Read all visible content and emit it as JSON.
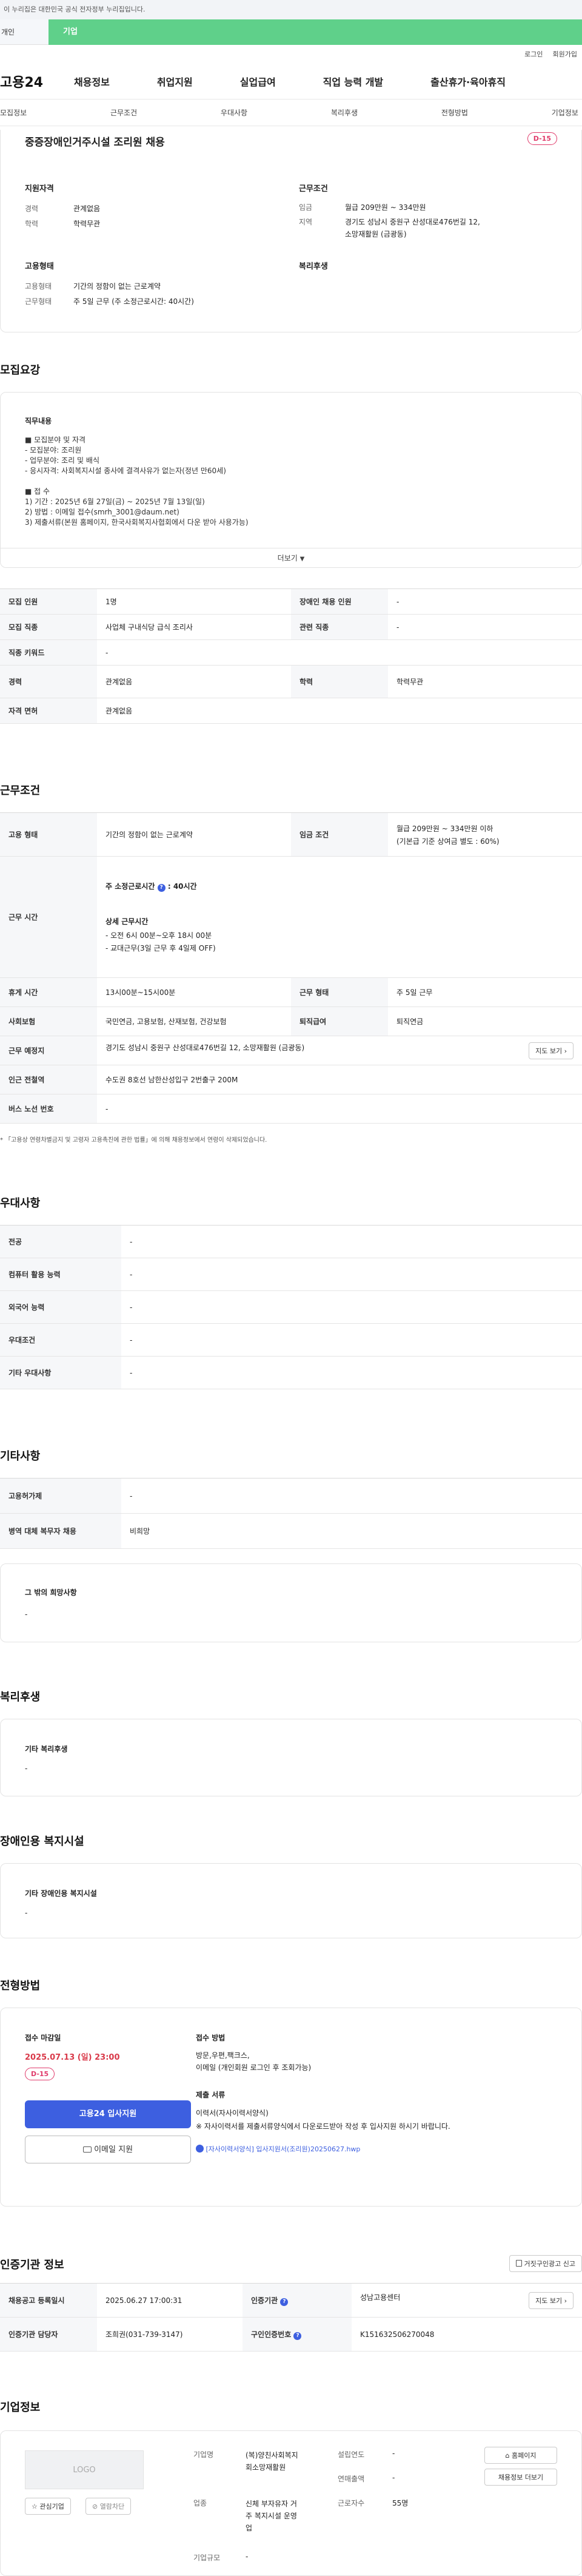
{
  "gov_notice": "이 누리집은 대한민국 공식 전자정부 누리집입니다.",
  "tabs": {
    "personal": "개인",
    "company": "기업"
  },
  "util": {
    "login": "로그인",
    "join": "회원가입"
  },
  "logo": "고용24",
  "gnb": [
    "채용정보",
    "취업지원",
    "실업급여",
    "직업 능력 개발",
    "출산휴가·육아휴직"
  ],
  "anchors": [
    "모집정보",
    "근무조건",
    "우대사항",
    "복리후생",
    "전형방법",
    "기업정보"
  ],
  "job": {
    "title": "중증장애인거주시설 조리원 채용",
    "dday": "D-15",
    "qual_head": "지원자격",
    "qual": [
      {
        "k": "경력",
        "v": "관계없음"
      },
      {
        "k": "학력",
        "v": "학력무관"
      }
    ],
    "cond_head": "근무조건",
    "cond": [
      {
        "k": "임금",
        "v": "월급 209만원 ~ 334만원"
      },
      {
        "k": "지역",
        "v": "경기도 성남시 중원구 산성대로476번길 12, 소망재활원 (금광동)"
      }
    ],
    "emp_head": "고용형태",
    "emp": [
      {
        "k": "고용형태",
        "v": "기간의 정함이 없는 근로계약"
      },
      {
        "k": "근무형태",
        "v": "주 5일 근무 (주 소정근로시간: 40시간)"
      }
    ],
    "welfare_head": "복리후생"
  },
  "recruit": {
    "title": "모집요강",
    "content_head": "직무내용",
    "content_lines": [
      "■ 모집분야 및 자격",
      "- 모집분야: 조리원",
      "- 업무분야: 조리 및 배식",
      "- 응시자격: 사회복지시설 종사에 결격사유가 없는자(정년 만60세)",
      "",
      "■ 접 수",
      "1) 기간 : 2025년 6월 27일(금) ~ 2025년 7월 13일(일)",
      "2) 방법 : 이메일 접수(smrh_3001@daum.net)",
      "3) 제출서류(본원 홈페이지, 한국사회복지사협회에서 다운 받아 사용가능)"
    ],
    "more": "더보기",
    "rows": [
      {
        "k1": "모집 인원",
        "v1": "1명",
        "k2": "장애인 채용 인원",
        "v2": "-"
      },
      {
        "k1": "모집 직종",
        "v1": "사업체 구내식당 급식 조리사",
        "k2": "관련 직종",
        "v2": "-"
      },
      {
        "k1": "직종 키워드",
        "v1": "-"
      },
      {
        "k1": "경력",
        "v1": "관계없음",
        "k2": "학력",
        "v2": "학력무관"
      },
      {
        "k1": "자격 면허",
        "v1": "관계없음"
      }
    ]
  },
  "work": {
    "title": "근무조건",
    "emp_k": "고용 형태",
    "emp_v": "기간의 정함이 없는 근로계약",
    "wage_k": "임금 조건",
    "wage_v1": "월급 209만원 ~ 334만원 이하",
    "wage_v2": "(기본급 기준 상여금 별도 : 60%)",
    "time_k": "근무 시간",
    "time_weekly": "주 소정근로시간",
    "time_weekly_v": ": 40시간",
    "time_detail_head": "상세 근무시간",
    "time_detail": [
      "- 오전 6시 00분~오후 18시 00분",
      "- 교대근무(3일 근무 후 4일제 OFF)"
    ],
    "rest_k": "휴게 시간",
    "rest_v": "13시00분~15시00분",
    "form_k": "근무 형태",
    "form_v": "주 5일 근무",
    "ins_k": "사회보험",
    "ins_v": "국민연금, 고용보험, 산재보험, 건강보험",
    "ret_k": "퇴직급여",
    "ret_v": "퇴직연금",
    "place_k": "근무 예정지",
    "place_v": "경기도 성남시 중원구 산성대로476번길 12, 소망재활원 (금광동)",
    "map_btn": "지도 보기",
    "station_k": "인근 전철역",
    "station_v": "수도권 8호선 남한산성입구 2번출구 200M",
    "bus_k": "버스 노선 번호",
    "bus_v": "-",
    "note": "* 「고용상 연령차별금지 및 고령자 고용촉진에 관한 법률」에 의해 채용정보에서 연령이 삭제되었습니다."
  },
  "prefer": {
    "title": "우대사항",
    "rows": [
      {
        "k": "전공",
        "v": "-"
      },
      {
        "k": "컴퓨터 활용 능력",
        "v": "-"
      },
      {
        "k": "외국어 능력",
        "v": "-"
      },
      {
        "k": "우대조건",
        "v": "-"
      },
      {
        "k": "기타 우대사항",
        "v": "-"
      }
    ]
  },
  "etc": {
    "title": "기타사항",
    "rows": [
      {
        "k": "고용허가제",
        "v": "-"
      },
      {
        "k": "병역 대체 복무자 채용",
        "v": "비희망"
      }
    ],
    "box_head": "그 밖의 희망사항",
    "box_v": "-"
  },
  "welfare": {
    "title": "복리후생",
    "head": "기타 복리후생",
    "v": "-"
  },
  "disabled": {
    "title": "장애인용 복지시설",
    "head": "기타 장애인용 복지시설",
    "v": "-"
  },
  "screening": {
    "title": "전형방법",
    "deadline_head": "접수 마감일",
    "deadline": "2025.07.13 (일) 23:00",
    "dday": "D-15",
    "apply_btn": "고용24 입사지원",
    "email_btn": "이메일 지원",
    "method_head": "접수 방법",
    "method_lines": [
      "방문,우편,팩크스,",
      "이메일 (개인회원 로그인 후 조회가능)"
    ],
    "docs_head": "제출 서류",
    "docs_lines": [
      "이력서(자사이력서양식)",
      "※ 자사이력서를 제출서류양식에서 다운로드받아 작성 후 입사지원 하시기 바랍니다."
    ],
    "file": "[자사이력서양식] 입사지원서(조리원)20250627.hwp"
  },
  "cert": {
    "title": "인증기관 정보",
    "report_btn": "거짓구인광고 신고",
    "rows": [
      {
        "k1": "채용공고 등록일시",
        "v1": "2025.06.27 17:00:31",
        "k2": "인증기관",
        "v2": "성남고용센터",
        "btn": "지도 보기"
      },
      {
        "k1": "인증기관 담당자",
        "v1": "조희권(031-739-3147)",
        "k2": "구인인증번호",
        "v2": "K151632506270048"
      }
    ]
  },
  "company": {
    "title": "기업정보",
    "logo": "LOGO",
    "interest_btn": "관심기업",
    "block_btn": "열람차단",
    "name_k": "기업명",
    "name_v": [
      "(복)양친사회복지",
      "회소망재활원"
    ],
    "year_k": "설립연도",
    "year_v": "-",
    "sales_k": "연매출액",
    "sales_v": "-",
    "industry_k": "업종",
    "industry_v": [
      "신체 부자유자 거",
      "주 복지시설 운영",
      "업"
    ],
    "emp_k": "근로자수",
    "emp_v": "55명",
    "scale_k": "기업규모",
    "scale_v": "-",
    "home_btn": "홈페이지",
    "list_btn": "채용정보 더보기"
  },
  "colors": {
    "green": "#5fd08a",
    "blue": "#3d5fe0",
    "pink": "#e03b6b",
    "deadline": "#d93a4a"
  }
}
